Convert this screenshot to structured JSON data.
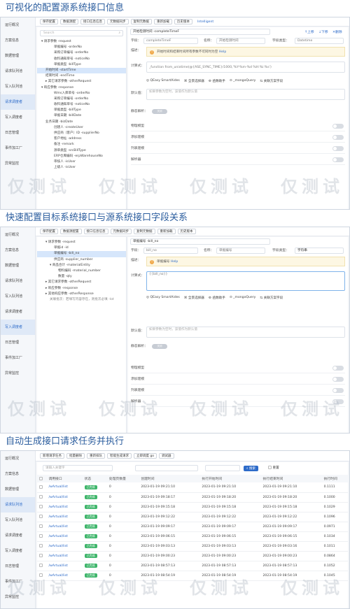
{
  "s1": {
    "title": "可视化的配置源系统接口信息",
    "sidebar": [
      "运行概况",
      "方案信息",
      "数据管理",
      "请求队列池",
      "写入队列池",
      "请求调度者",
      "写入调度者",
      "日志管理",
      "事件加工厂",
      "异常监控"
    ],
    "sidebar_active": 5,
    "toolbar": [
      "保存配置",
      "数据源配",
      "接口信息信息",
      "元数据同步",
      "复制元数据",
      "重新加载",
      "历史版本"
    ],
    "toolbar_tag": "Intelligent",
    "search_placeholder": "Search",
    "tree": [
      {
        "t": "▾ 请求参数 -request",
        "i": 0
      },
      {
        "t": "单据编号 -orderNo",
        "i": 3
      },
      {
        "t": "采购订单编号 -orderNo",
        "i": 3
      },
      {
        "t": "收料通知单号 -noticeNo",
        "i": 3
      },
      {
        "t": "单据类型 -billType",
        "i": 3
      },
      {
        "t": "开始时间 -startTime",
        "i": 1
      },
      {
        "t": "结束时间 -endTime",
        "i": 1
      },
      {
        "t": "▸ 其它请求参数 -otherRequest",
        "i": 1
      },
      {
        "t": "▾ 响应参数 -response",
        "i": 0
      },
      {
        "t": "Wms入库单号 -orderNo",
        "i": 3
      },
      {
        "t": "采购订单编号 -orderNo",
        "i": 3
      },
      {
        "t": "收料通知单号 -noticeNo",
        "i": 3
      },
      {
        "t": "单据类型 -billType",
        "i": 3
      },
      {
        "t": "单据日期 -billDate",
        "i": 3
      },
      {
        "t": "业务日期 -bizDate",
        "i": 1
      },
      {
        "t": "创建人 -createUser",
        "i": 3
      },
      {
        "t": "供应商（客户）ID -supplierNo",
        "i": 3
      },
      {
        "t": "客户地址 -address",
        "i": 3
      },
      {
        "t": "备注 -remark",
        "i": 3
      },
      {
        "t": "源单类型 -srcBillType",
        "i": 3
      },
      {
        "t": "ERP仓库编码 -erpWarehouseNo",
        "i": 3
      },
      {
        "t": "审核人 -isUser",
        "i": 3
      },
      {
        "t": "上级人 -isUser",
        "i": 3
      }
    ],
    "tree_selected": 5,
    "field_title": "开始检测时间 -completeTimeF",
    "nav": [
      "上移",
      "下移",
      "删除"
    ],
    "row2": {
      "l1": "字段：",
      "v1": "completeTimeF",
      "l2": "名称：",
      "v2": "开始检测时间",
      "l3": "字段类型：",
      "v3": "Datetime"
    },
    "desc_label": "描述：",
    "warn": "开始时间和结束时间所有参数不可同时为空",
    "warn_link": "Help",
    "formula_label": "计算式：",
    "formula": "_function from_unixtime(@{ASE_SYNC_TIME}/1000,'%Y-%m-%d %H:%i:%s')",
    "tools": [
      "QEasy SmartAides",
      "全景选择器",
      "函数助手",
      "_mongoQuery",
      "关联方案字段"
    ],
    "default_label": "默认值：",
    "default_ph": "如果参数为空时，该值作为默认值",
    "static_label": "静态解析：",
    "toggle_text": "关闭",
    "opts": [
      "物理模型",
      "添加建模",
      "列表建模",
      "解析器"
    ]
  },
  "s2": {
    "title": "快速配置目标系统接口与源系统接口字段关系",
    "sidebar": [
      "运行概况",
      "方案信息",
      "数据管理",
      "请求队列池",
      "写入队列池",
      "请求调度者",
      "写入调度者",
      "日志管理",
      "事件加工厂",
      "异常监控"
    ],
    "sidebar_active": 6,
    "toolbar": [
      "保存配置",
      "数据源配置",
      "接口信息信息",
      "元数据同步",
      "复制元数据",
      "重新加载",
      "历史版本"
    ],
    "tree": [
      {
        "t": "▾ 请求参数 -request",
        "i": 1
      },
      {
        "t": "单据id -id",
        "i": 3
      },
      {
        "t": "单据编号 -bill_no",
        "i": 3
      },
      {
        "t": "供应商 -supplier_number",
        "i": 3
      },
      {
        "t": "▾ 商品合计 -materialEntity",
        "i": 2
      },
      {
        "t": "物料编码 -material_number",
        "i": 4
      },
      {
        "t": "数量 -qty",
        "i": 4
      },
      {
        "t": "▸ 其它请求参数 -otherRequest",
        "i": 1
      },
      {
        "t": "▸ 响应参数 -response",
        "i": 1
      },
      {
        "t": "▸ 其他响应参数 -otherResponse",
        "i": 1
      }
    ],
    "tree_note": "关联批次：若填写内容存在，则批次必填 -lot",
    "tree_selected": 2,
    "field_title": "单据编号 -bill_no",
    "row2": {
      "l1": "字段：",
      "v1": "bill_no",
      "l2": "名称：",
      "v2": "单据编号",
      "l3": "字段类型：",
      "v3": "字符串"
    },
    "desc_label": "描述：",
    "warn": "单据编号",
    "warn_link": "Help",
    "formula_label": "计算式：",
    "formula": "{{bill_no}}",
    "tools": [
      "QEasy SmartAides",
      "全景选择器",
      "函数助手",
      "_mongoQuery",
      "关联方案字段"
    ],
    "default_label": "默认值：",
    "default_ph": "如果参数为空时，该值作为默认值",
    "static_label": "静态解析：",
    "toggle_text": "关闭",
    "opts": [
      "物理模型",
      "添加建模",
      "列表建模",
      "解析器"
    ]
  },
  "s3": {
    "title": "自动生成接口请求任务并执行",
    "sidebar": [
      "运行概况",
      "方案信息",
      "数据管理",
      "请求队列池",
      "写入队列池",
      "请求调度者",
      "写入调度者",
      "日志管理",
      "事件加工厂",
      "异常监控"
    ],
    "sidebar_active": 3,
    "toolbar": [
      "新增请求任务",
      "批量删除",
      "重新排队",
      "智能生成请求",
      "立即调度 go",
      "调试器"
    ],
    "search_label": "请输入关键字",
    "search_btn": "搜索",
    "reset_btn": "重置",
    "columns": [
      "调用接口",
      "状态",
      "处理页数量",
      "创建时间",
      "执行开始时间",
      "执行结束时间",
      "执行时间"
    ],
    "rows": [
      [
        "/wArtual/list",
        "已完成",
        "0",
        "2023-01-19 09:21:10",
        "2023-01-19 09:21:10",
        "2023-01-19 09:21:10",
        "0.1111"
      ],
      [
        "/wArtual/list",
        "已完成",
        "0",
        "2023-01-19 09:18:17",
        "2023-01-19 09:18:20",
        "2023-01-19 09:18:20",
        "0.1000"
      ],
      [
        "/wArtual/list",
        "已完成",
        "0",
        "2023-01-19 09:15:18",
        "2023-01-19 09:15:18",
        "2023-01-19 09:15:18",
        "0.1029"
      ],
      [
        "/wArtual/list",
        "已完成",
        "0",
        "2023-01-19 09:12:22",
        "2023-01-19 09:12:22",
        "2023-01-19 09:12:22",
        "0.1096"
      ],
      [
        "/wArtual/list",
        "已完成",
        "0",
        "2023-01-19 09:09:17",
        "2023-01-19 09:09:17",
        "2023-01-19 09:09:17",
        "0.0971"
      ],
      [
        "/wArtual/list",
        "已完成",
        "0",
        "2023-01-19 09:06:15",
        "2023-01-19 09:06:15",
        "2023-01-19 09:06:15",
        "0.1034"
      ],
      [
        "/wArtual/list",
        "已完成",
        "0",
        "2023-01-19 09:03:13",
        "2023-01-19 09:03:13",
        "2023-01-19 09:03:16",
        "0.1011"
      ],
      [
        "/wArtual/list",
        "已完成",
        "0",
        "2023-01-19 09:00:23",
        "2023-01-19 09:00:23",
        "2023-01-19 09:00:23",
        "0.0864"
      ],
      [
        "/wArtual/list",
        "已完成",
        "0",
        "2023-01-19 08:57:13",
        "2023-01-19 08:57:13",
        "2023-01-19 08:57:13",
        "0.1052"
      ],
      [
        "/wArtual/list",
        "已完成",
        "0",
        "2023-01-19 08:54:19",
        "2023-01-19 08:54:19",
        "2023-01-19 08:54:19",
        "0.1045"
      ]
    ]
  },
  "watermark": "仅测试"
}
